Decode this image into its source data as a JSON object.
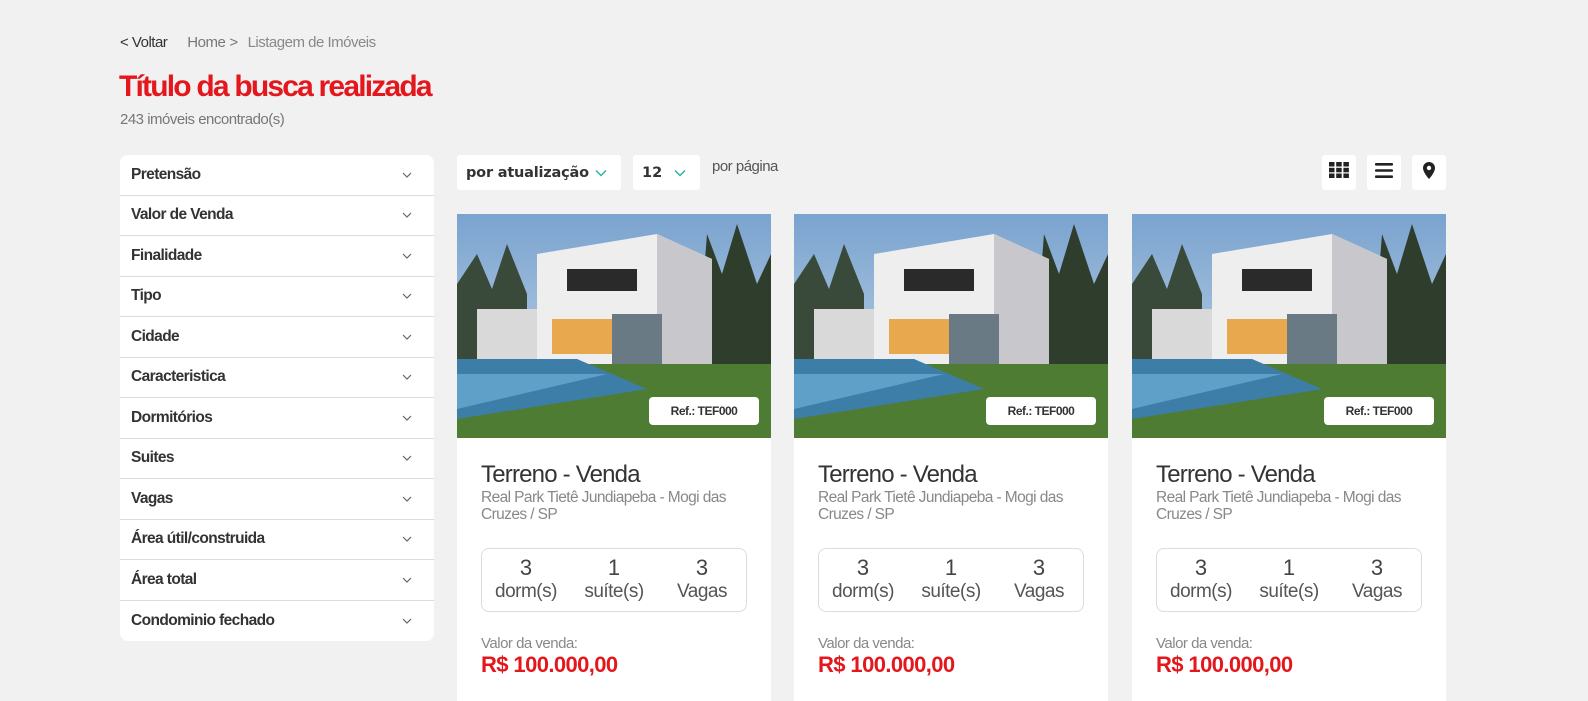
{
  "breadcrumb": {
    "back": "< Voltar",
    "home": "Home",
    "separator": ">",
    "current": "Listagem de Imóveis"
  },
  "header": {
    "title": "Título da busca realizada",
    "count": "243 imóveis encontrado(s)"
  },
  "filters": [
    {
      "label": "Pretensão"
    },
    {
      "label": "Valor de Venda"
    },
    {
      "label": "Finalidade"
    },
    {
      "label": "Tipo"
    },
    {
      "label": "Cidade"
    },
    {
      "label": "Caracteristica"
    },
    {
      "label": "Dormitórios"
    },
    {
      "label": "Suites"
    },
    {
      "label": "Vagas"
    },
    {
      "label": "Área útil/construida"
    },
    {
      "label": "Área total"
    },
    {
      "label": "Condominio fechado"
    }
  ],
  "toolbar": {
    "sort_value": "por atualização",
    "per_page_value": "12",
    "per_page_label": "por página",
    "view_icons": [
      "grid-view-icon",
      "list-view-icon",
      "map-pin-icon"
    ]
  },
  "colors": {
    "accent": "#e4171c",
    "chevron": "#2bb5a3",
    "background": "#f1f1f1"
  },
  "listings": [
    {
      "ref": "Ref.: TEF000",
      "title": "Terreno - Venda",
      "address": "Real Park Tietê Jundiapeba - Mogi das Cruzes / SP",
      "features": [
        {
          "num": "3",
          "label": "dorm(s)"
        },
        {
          "num": "1",
          "label": "suíte(s)"
        },
        {
          "num": "3",
          "label": "Vagas"
        }
      ],
      "price_label": "Valor da venda:",
      "price": "R$ 100.000,00"
    },
    {
      "ref": "Ref.: TEF000",
      "title": "Terreno - Venda",
      "address": "Real Park Tietê Jundiapeba - Mogi das Cruzes / SP",
      "features": [
        {
          "num": "3",
          "label": "dorm(s)"
        },
        {
          "num": "1",
          "label": "suíte(s)"
        },
        {
          "num": "3",
          "label": "Vagas"
        }
      ],
      "price_label": "Valor da venda:",
      "price": "R$ 100.000,00"
    },
    {
      "ref": "Ref.: TEF000",
      "title": "Terreno - Venda",
      "address": "Real Park Tietê Jundiapeba - Mogi das Cruzes / SP",
      "features": [
        {
          "num": "3",
          "label": "dorm(s)"
        },
        {
          "num": "1",
          "label": "suíte(s)"
        },
        {
          "num": "3",
          "label": "Vagas"
        }
      ],
      "price_label": "Valor da venda:",
      "price": "R$ 100.000,00"
    }
  ]
}
